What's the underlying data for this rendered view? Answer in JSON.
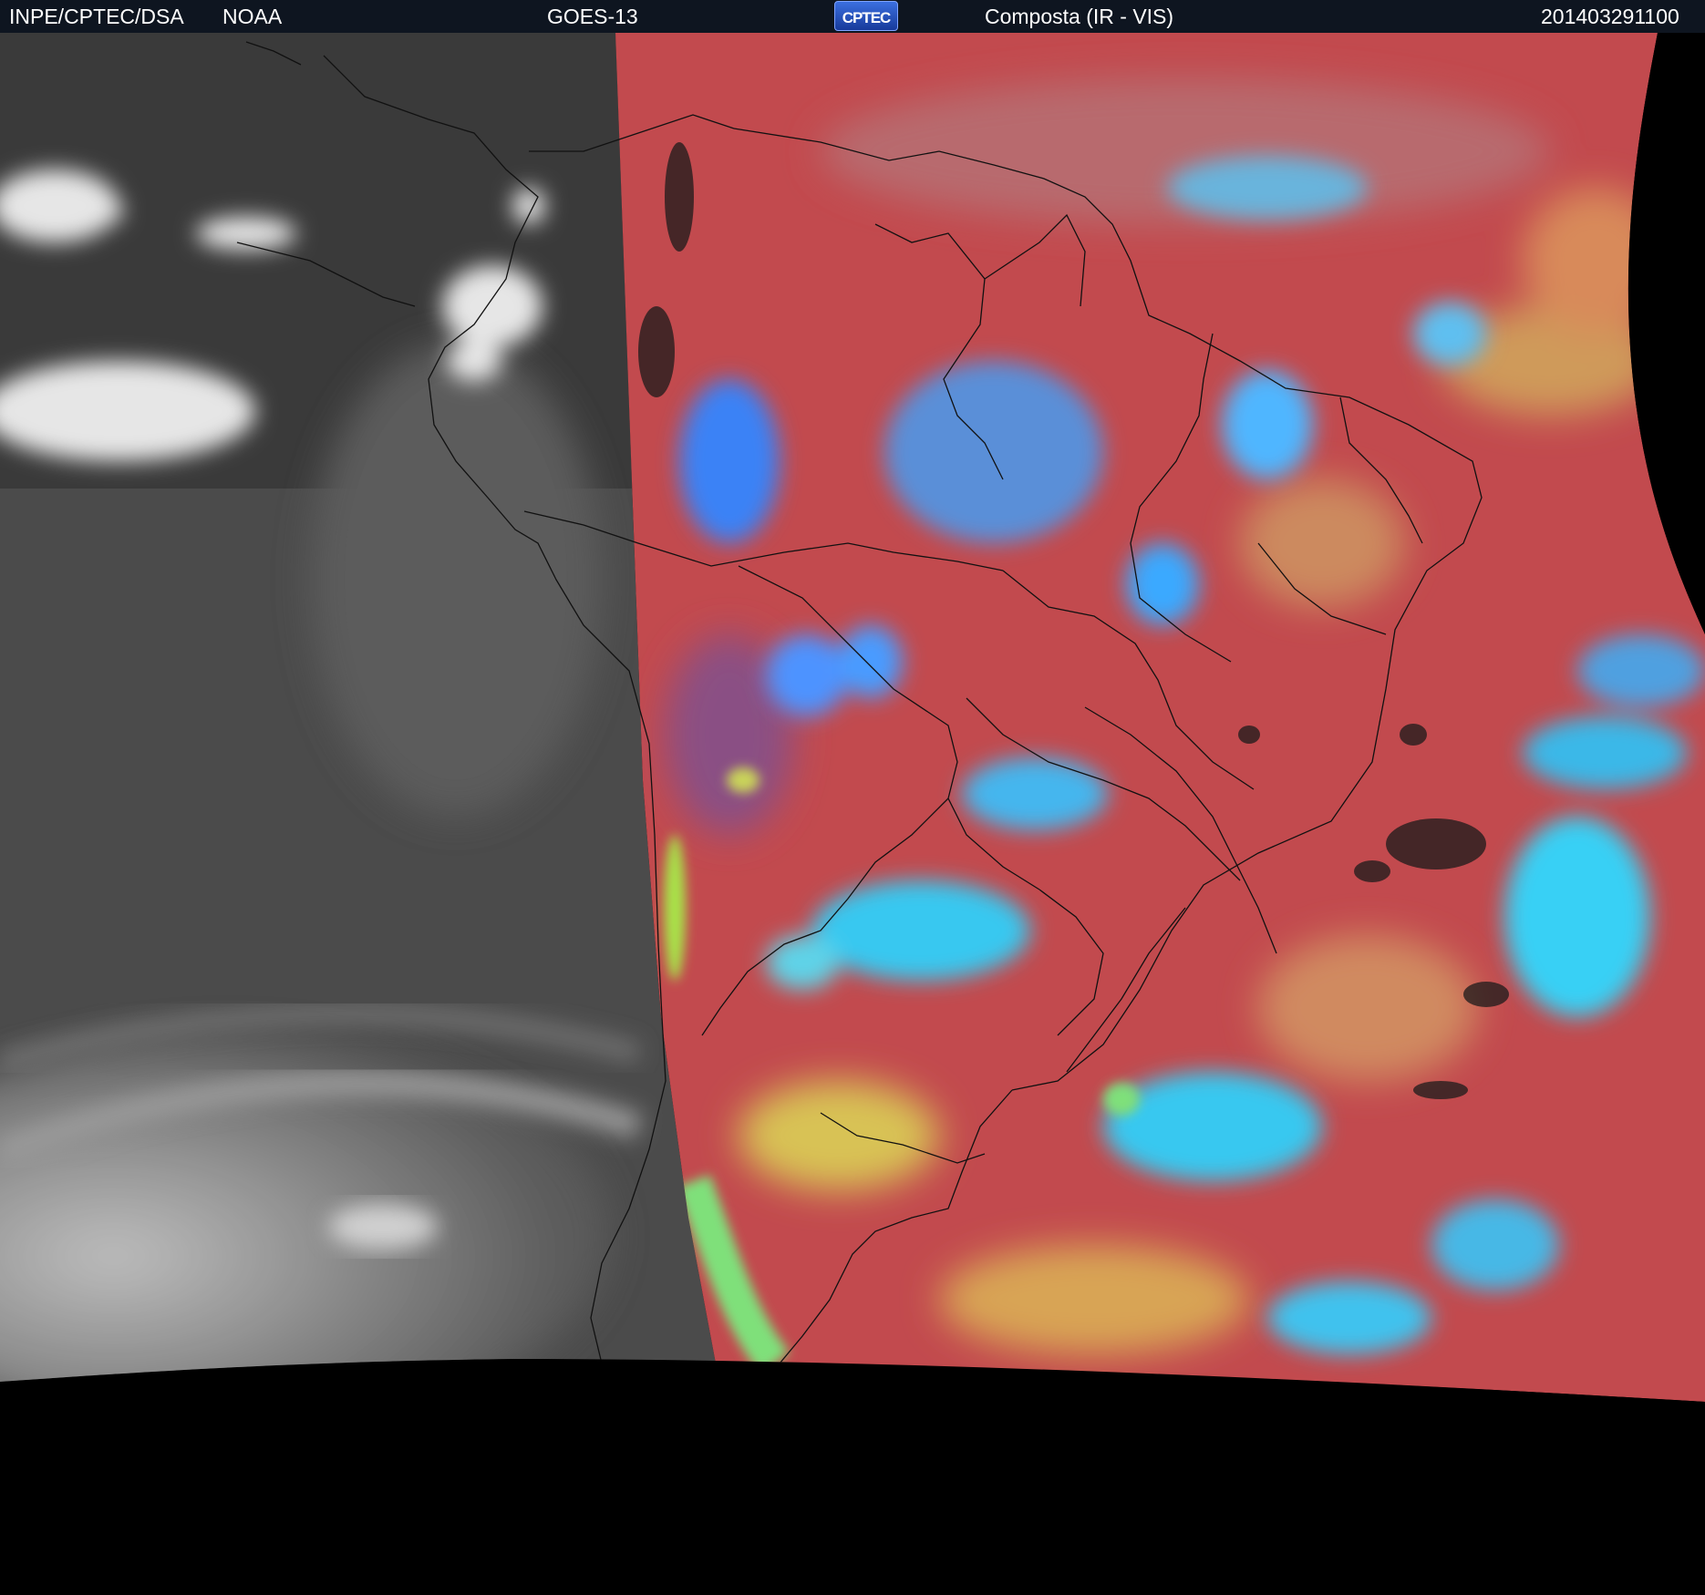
{
  "header": {
    "agency": "INPE/CPTEC/DSA",
    "partner": "NOAA",
    "satellite": "GOES-13",
    "logo_text": "CPTEC",
    "product": "Composta (IR - VIS)",
    "timestamp": "201403291100"
  },
  "colors": {
    "background": "#000000",
    "header_bg": "#0e1520",
    "ir_gray_dark": "#4a4a4a",
    "ir_gray_light": "#e8e8e8",
    "composite_red": "#c24a4e",
    "composite_cyan": "#37c8f0",
    "composite_blue": "#3b82f6",
    "composite_yellow": "#d8c255",
    "composite_green": "#7fe07a",
    "border_lines": "#111111"
  }
}
